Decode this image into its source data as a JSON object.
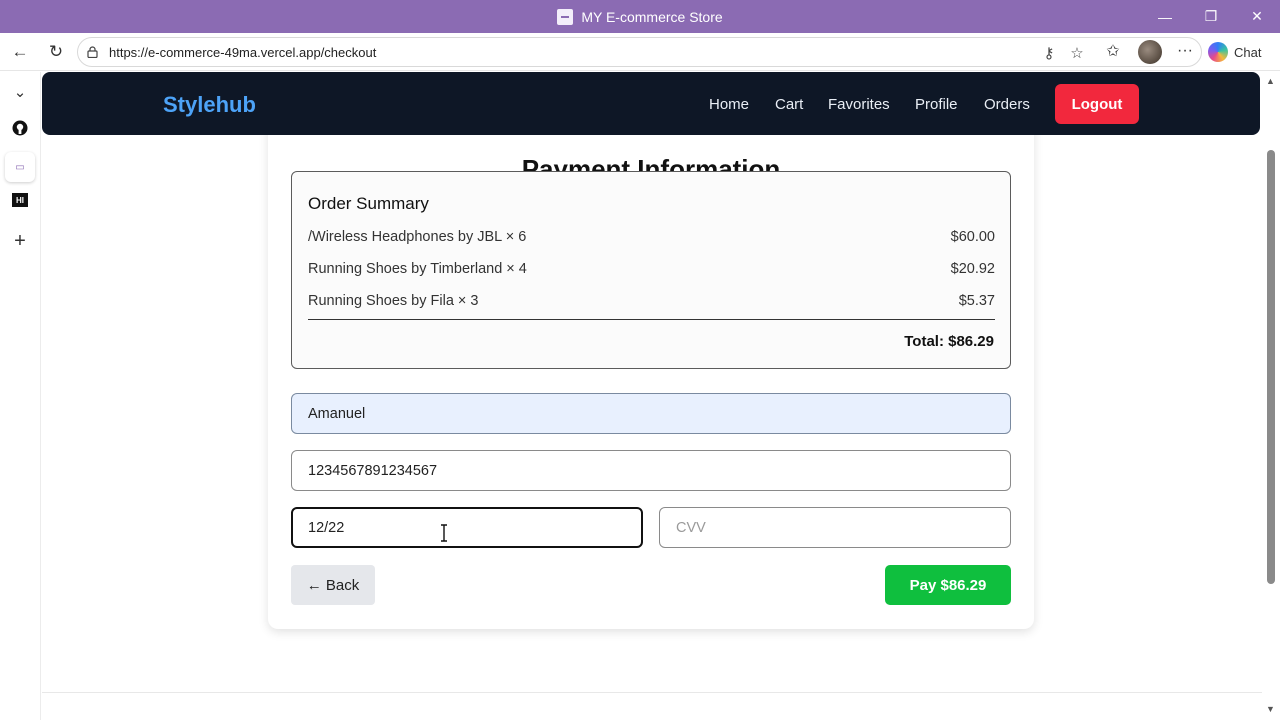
{
  "window": {
    "title": "MY E-commerce Store",
    "minimize_icon": "minimize-icon",
    "restore_icon": "restore-icon",
    "close_icon": "close-icon"
  },
  "browser": {
    "url": "https://e-commerce-49ma.vercel.app/checkout",
    "chat_label": "Chat",
    "icons": [
      "back-icon",
      "refresh-icon",
      "lock-icon",
      "key-icon",
      "star-icon",
      "favorites-icon",
      "avatar",
      "more-icon",
      "copilot-icon"
    ]
  },
  "sidebar": {
    "icons": [
      "chevron-down-icon",
      "github-icon",
      "ecommerce-tab-icon",
      "hi-badge-icon",
      "plus-icon"
    ],
    "hi_badge_text": "HI"
  },
  "site": {
    "brand": "Stylehub",
    "nav": [
      "Home",
      "Cart",
      "Favorites",
      "Profile",
      "Orders"
    ],
    "logout": "Logout",
    "brand_color": "#4da3f7",
    "logout_color": "#f2283d"
  },
  "checkout": {
    "title": "Payment Information",
    "summary_title": "Order Summary",
    "items": [
      {
        "name": "/Wireless Headphones by JBL × 6",
        "price": "$60.00"
      },
      {
        "name": "Running Shoes by Timberland × 4",
        "price": "$20.92"
      },
      {
        "name": "Running Shoes by Fila × 3",
        "price": "$5.37"
      }
    ],
    "total": "Total: $86.29",
    "name_value": "Amanuel",
    "card_value": "1234567891234567",
    "expiry_value": "12/22",
    "cvv_placeholder": "CVV",
    "back_label": "← Back",
    "pay_label": "Pay $86.29",
    "pay_color": "#0fbf3e"
  }
}
